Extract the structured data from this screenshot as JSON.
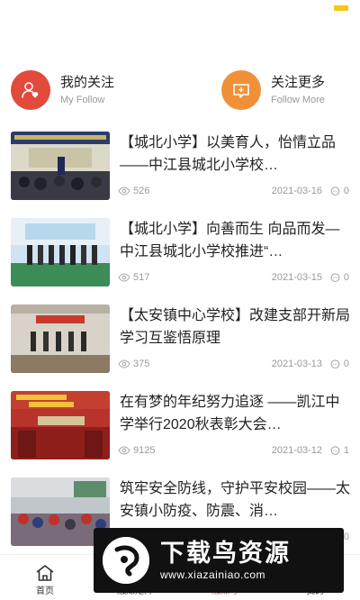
{
  "colors": {
    "accent": "#e24a3c",
    "follow_more": "#f0913a",
    "battery": "#f5c518",
    "meta": "#9a9a9a"
  },
  "follow": {
    "my": {
      "title": "我的关注",
      "subtitle": "My Follow",
      "icon": "user-heart-icon"
    },
    "more": {
      "title": "关注更多",
      "subtitle": "Follow  More",
      "icon": "tv-add-icon"
    }
  },
  "news": [
    {
      "title": "【城北小学】以美育人，怡情立品 ——中江县城北小学校…",
      "views": "526",
      "date": "2021-03-16",
      "comments": "0"
    },
    {
      "title": "【城北小学】向善而生 向品而发—中江县城北小学校推进“…",
      "views": "517",
      "date": "2021-03-15",
      "comments": "0"
    },
    {
      "title": "【太安镇中心学校】改建支部开新局　学习互鉴悟原理",
      "views": "375",
      "date": "2021-03-13",
      "comments": "0"
    },
    {
      "title": "在有梦的年纪努力追逐 ——凯江中学举行2020秋表彰大会…",
      "views": "9125",
      "date": "2021-03-12",
      "comments": "1"
    },
    {
      "title": "筑牢安全防线，守护平安校园——太安镇小防疫、防震、消…",
      "views": "",
      "date": "",
      "comments": "0"
    }
  ],
  "tabs": [
    {
      "label": "首页",
      "icon": "home-icon",
      "active": false
    },
    {
      "label": "融媒矩阵",
      "icon": "",
      "active": false
    },
    {
      "label": "融媒号",
      "icon": "",
      "active": true
    },
    {
      "label": "我的",
      "icon": "",
      "active": false
    }
  ],
  "watermark": {
    "big": "下载鸟资源",
    "url": "www.xiazainiao.com"
  }
}
